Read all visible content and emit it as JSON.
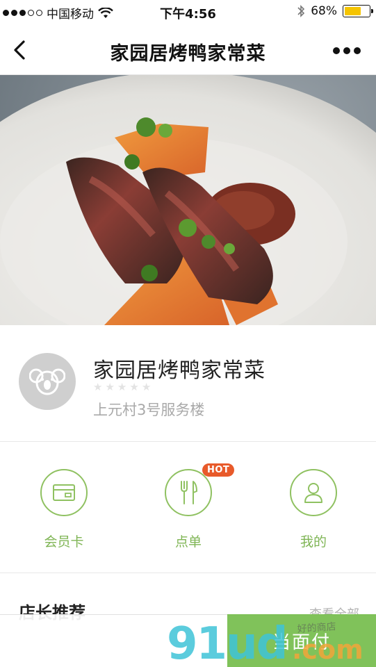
{
  "status_bar": {
    "carrier": "中国移动",
    "time": "下午4:56",
    "battery_percent_text": "68%",
    "battery_level": 0.68,
    "signal_bars_filled": 3,
    "signal_bars_total": 5
  },
  "nav": {
    "title": "家园居烤鸭家常菜",
    "back_icon": "chevron-left-icon",
    "more_icon": "more-dots-icon"
  },
  "shop": {
    "name": "家园居烤鸭家常菜",
    "rating": 0,
    "rating_max": 5,
    "address": "上元村3号服务楼",
    "avatar_icon": "koala-icon"
  },
  "actions": [
    {
      "label": "会员卡",
      "icon": "card-icon"
    },
    {
      "label": "点单",
      "icon": "fork-knife-icon",
      "badge": "HOT"
    },
    {
      "label": "我的",
      "icon": "user-icon"
    }
  ],
  "recommend": {
    "title": "店长推荐",
    "more_label": "查看全部"
  },
  "bottom_bar": {
    "pay_label": "当面付"
  },
  "watermark": {
    "text": "91ud.com",
    "sub_text": "好的商店"
  },
  "colors": {
    "accent_green": "#80c25a",
    "hot_badge": "#e85a2a",
    "battery_yellow": "#f5c400"
  }
}
